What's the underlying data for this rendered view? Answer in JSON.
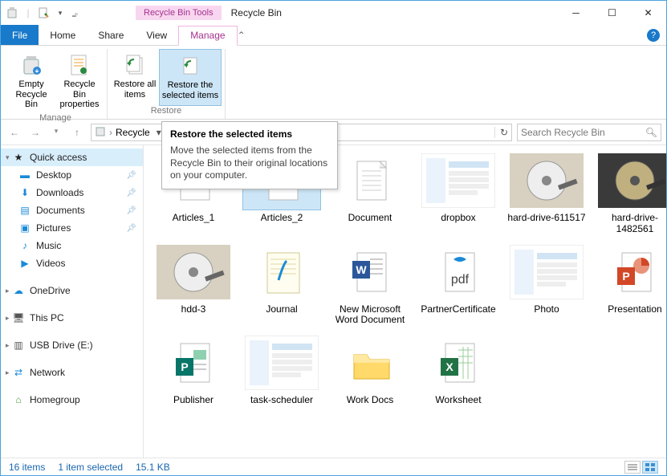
{
  "window": {
    "context_tab": "Recycle Bin Tools",
    "title": "Recycle Bin"
  },
  "tabs": {
    "file": "File",
    "home": "Home",
    "share": "Share",
    "view": "View",
    "manage": "Manage"
  },
  "ribbon": {
    "empty": "Empty Recycle Bin",
    "properties": "Recycle Bin properties",
    "restore_all": "Restore all items",
    "restore_selected": "Restore the selected items",
    "group_manage": "Manage",
    "group_restore": "Restore"
  },
  "tooltip": {
    "title": "Restore the selected items",
    "body": "Move the selected items from the Recycle Bin to their original locations on your computer."
  },
  "address": {
    "crumb1": "Recycle"
  },
  "search": {
    "placeholder": "Search Recycle Bin"
  },
  "sidebar": {
    "quick_access": "Quick access",
    "desktop": "Desktop",
    "downloads": "Downloads",
    "documents": "Documents",
    "pictures": "Pictures",
    "music": "Music",
    "videos": "Videos",
    "onedrive": "OneDrive",
    "this_pc": "This PC",
    "usb": "USB Drive (E:)",
    "network": "Network",
    "homegroup": "Homegroup"
  },
  "items": [
    {
      "name": "Articles_1",
      "kind": "word"
    },
    {
      "name": "Articles_2",
      "kind": "word",
      "selected": true
    },
    {
      "name": "Document",
      "kind": "text"
    },
    {
      "name": "dropbox",
      "kind": "image-screenshot"
    },
    {
      "name": "hard-drive-611517",
      "kind": "image-hdd"
    },
    {
      "name": "hard-drive-1482561",
      "kind": "image-hdd2"
    },
    {
      "name": "hdd-3",
      "kind": "image-hdd"
    },
    {
      "name": "Journal",
      "kind": "journal"
    },
    {
      "name": "New Microsoft Word Document",
      "kind": "word"
    },
    {
      "name": "PartnerCertificate",
      "kind": "pdf"
    },
    {
      "name": "Photo",
      "kind": "image-screenshot"
    },
    {
      "name": "Presentation",
      "kind": "ppt"
    },
    {
      "name": "Publisher",
      "kind": "pub"
    },
    {
      "name": "task-scheduler",
      "kind": "image-screenshot"
    },
    {
      "name": "Work Docs",
      "kind": "folder"
    },
    {
      "name": "Worksheet",
      "kind": "xls"
    }
  ],
  "status": {
    "count": "16 items",
    "selection": "1 item selected",
    "size": "15.1 KB"
  }
}
